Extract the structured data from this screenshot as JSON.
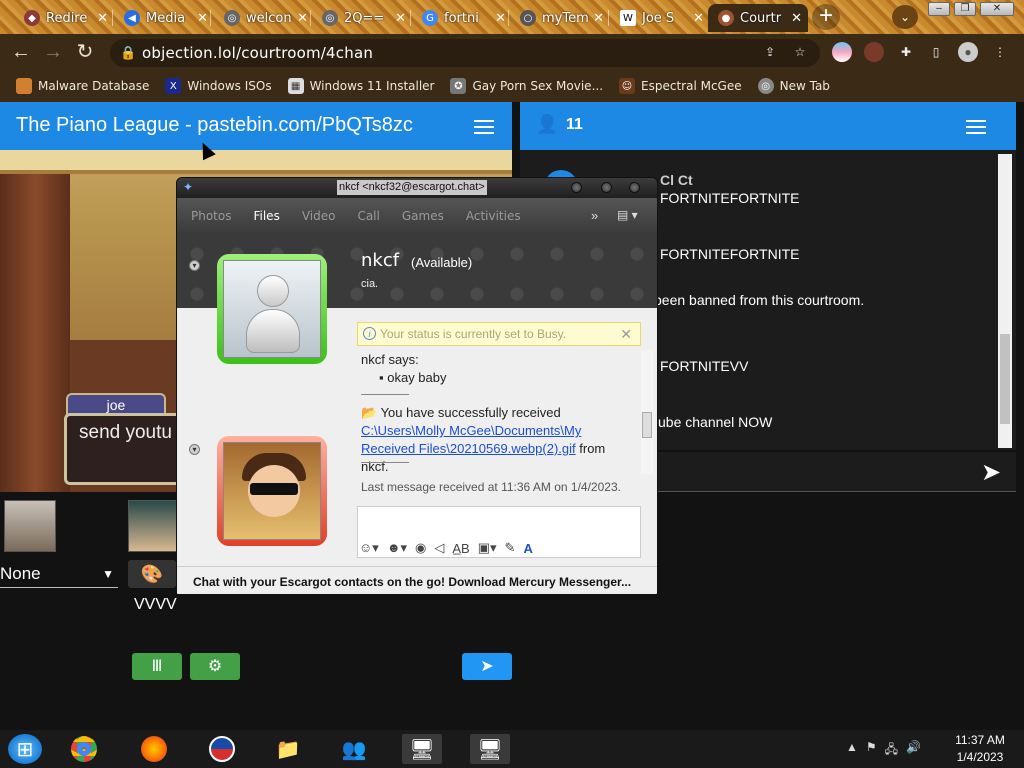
{
  "browser": {
    "tabs": [
      {
        "label": "Redire",
        "icon": "redirect-icon",
        "color": "#8b3a3a"
      },
      {
        "label": "Media",
        "icon": "media-icon",
        "color": "#2b6de0"
      },
      {
        "label": "welcon",
        "icon": "globe-icon",
        "color": "#666666"
      },
      {
        "label": "2Q==",
        "icon": "globe-icon",
        "color": "#666666"
      },
      {
        "label": "fortni",
        "icon": "google-icon",
        "color": "#4285f4"
      },
      {
        "label": "myTem",
        "icon": "blank-icon",
        "color": "#555555"
      },
      {
        "label": "Joe S",
        "icon": "wikipedia-icon",
        "color": "#ffffff"
      },
      {
        "label": "Courtr",
        "icon": "courtroom-icon",
        "color": "#a0522d"
      }
    ],
    "url": "objection.lol/courtroom/4chan",
    "bookmarks": [
      {
        "label": "Malware Database",
        "icon": "bookmark-icon"
      },
      {
        "label": "Windows ISOs",
        "icon": "x-icon"
      },
      {
        "label": "Windows 11 Installer",
        "icon": "image-icon"
      },
      {
        "label": "Gay Porn Sex Movie...",
        "icon": "award-icon"
      },
      {
        "label": "Espectral McGee",
        "icon": "avatar-icon"
      },
      {
        "label": "New Tab",
        "icon": "globe-icon"
      }
    ]
  },
  "courtroom": {
    "title": "The Piano League - pastebin.com/PbQTs8zc",
    "online_count": "11",
    "nameplate": "joe",
    "textbox_text": "send youtu",
    "character_select": "None",
    "username": "VVVV",
    "chat_messages": [
      "FORTNITEFORTNITE",
      "FORTNITEFORTNITE",
      "been banned from this courtroom.",
      "FORTNITEVV",
      "ube channel NOW"
    ],
    "chat_top_fragment": "Cl Ct"
  },
  "messenger": {
    "window_title": "nkcf <nkcf32@escargot.chat>",
    "menu": [
      "Photos",
      "Files",
      "Video",
      "Call",
      "Games",
      "Activities"
    ],
    "active_menu": "Files",
    "contact_name": "nkcf",
    "contact_status": "(Available)",
    "personal_message": "cia.",
    "busy_notice": "Your status is currently set to Busy.",
    "says_line": "nkcf says:",
    "message": "okay baby",
    "received_prefix": "You have successfully received",
    "received_link": "C:\\Users\\Molly McGee\\Documents\\My Received Files\\20210569.webp(2).gif",
    "received_suffix": "from nkcf.",
    "last_message": "Last message received at 11:36 AM on 1/4/2023.",
    "footer": "Chat with your Escargot contacts on the go! Download Mercury Messenger..."
  },
  "taskbar": {
    "time": "11:37 AM",
    "date": "1/4/2023"
  },
  "colors": {
    "accent_blue": "#1e88e5",
    "green_button": "#43a047",
    "chrome_frame": "#3b2a16"
  }
}
